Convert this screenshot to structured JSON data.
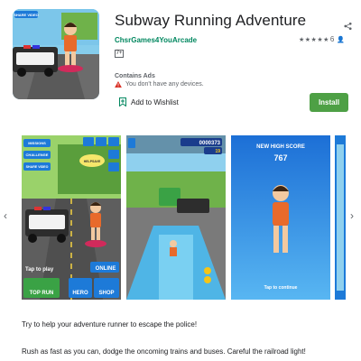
{
  "app": {
    "title": "Subway Running Adventure",
    "developer": "ChsrGames4You",
    "category": "Arcade",
    "rating_count": "6",
    "age_rating": "7+",
    "contains_ads": "Contains Ads",
    "device_warning": "You don't have any devices.",
    "wishlist": "Add to Wishlist",
    "install": "Install",
    "icon_badge": "SHARE VIDEO"
  },
  "screenshots": [
    {
      "buttons": [
        "MISSIONS",
        "CHALLENGE",
        "SHARE VIDEO"
      ],
      "sign": "HELPSAVE",
      "tap": "Tap to play",
      "online": "ONLINE",
      "top_run": "TOP RUN",
      "hero": "HERO",
      "shop": "SHOP"
    },
    {
      "score": "0000373",
      "coins": "19"
    },
    {
      "header": "NEW HIGH SCORE",
      "score": "767",
      "tap": "Tap to continue"
    }
  ],
  "description": [
    "Try to help your adventure runner to escape the police!",
    "Rush as fast as you can, dodge the oncoming trains and buses. Careful the railroad light!"
  ],
  "colors": {
    "accent": "#01875f",
    "install": "#4ea045"
  }
}
